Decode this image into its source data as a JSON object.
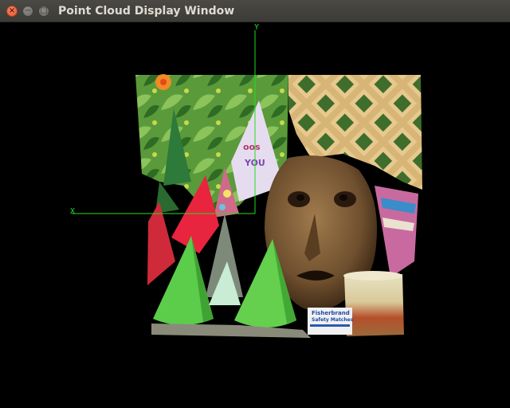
{
  "window": {
    "title": "Point Cloud Display Window",
    "close_glyph": "×",
    "min_glyph": "−",
    "max_glyph": "□"
  },
  "viewport": {
    "axes": {
      "x_label": "X",
      "y_label": "Y",
      "color": "#22dd22"
    },
    "background": "#000000",
    "scene_items": {
      "label_card_text": [
        "Fisherbrand",
        "Safety Matches"
      ]
    }
  }
}
